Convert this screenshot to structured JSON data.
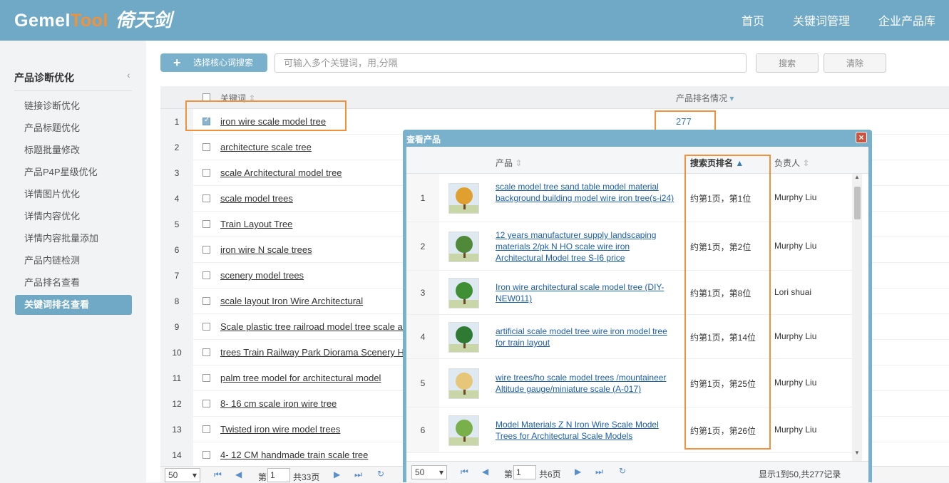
{
  "header": {
    "logo_a": "Gemel",
    "logo_b": "Tool",
    "logo_cn": "倚天剑",
    "nav": [
      "首页",
      "关键词管理",
      "企业产品库"
    ]
  },
  "sidebar": {
    "title": "产品诊断优化",
    "items": [
      "链接诊断优化",
      "产品标题优化",
      "标题批量修改",
      "产品P4P星级优化",
      "详情图片优化",
      "详情内容优化",
      "详情内容批量添加",
      "产品内链检测",
      "产品排名查看",
      "关键词排名查看"
    ],
    "active_index": 9
  },
  "toolbar": {
    "select_label": "选择核心词搜索",
    "input_placeholder": "可输入多个关键词，用,分隔",
    "search_label": "搜索",
    "clear_label": "清除"
  },
  "table": {
    "col_keyword": "关键词",
    "col_rank": "产品排名情况",
    "rows": [
      {
        "n": "1",
        "kw": "iron wire scale model tree",
        "rank": "277",
        "checked": true
      },
      {
        "n": "2",
        "kw": "architecture scale tree"
      },
      {
        "n": "3",
        "kw": "scale Architectural model tree"
      },
      {
        "n": "4",
        "kw": "scale model trees"
      },
      {
        "n": "5",
        "kw": "Train Layout Tree"
      },
      {
        "n": "6",
        "kw": "iron wire N scale trees"
      },
      {
        "n": "7",
        "kw": "scenery model trees"
      },
      {
        "n": "8",
        "kw": "scale layout Iron Wire Architectural"
      },
      {
        "n": "9",
        "kw": "Scale plastic tree railroad model tree scale ar"
      },
      {
        "n": "10",
        "kw": "trees Train Railway Park Diorama Scenery HO"
      },
      {
        "n": "11",
        "kw": "palm tree model for architectural model"
      },
      {
        "n": "12",
        "kw": "8- 16 cm scale iron wire tree"
      },
      {
        "n": "13",
        "kw": "Twisted iron wire model trees"
      },
      {
        "n": "14",
        "kw": "4- 12 CM handmade train scale tree"
      }
    ]
  },
  "pager": {
    "size": "50",
    "page_label": "第",
    "page": "1",
    "total": "共33页"
  },
  "dialog": {
    "title": "查看产品",
    "col_product": "产品",
    "col_rank": "搜索页排名",
    "col_owner": "负责人",
    "rows": [
      {
        "n": "1",
        "name": "scale model tree sand table model material background building model wire iron tree(s-i24)",
        "rank": "约第1页，第1位",
        "owner": "Murphy Liu",
        "icon": "autumn-tree-icon",
        "color": "#e0a030"
      },
      {
        "n": "2",
        "name": "12 years manufacturer supply landscaping materials 2/pk N HO scale wire iron Architectural Model tree S-I6 price",
        "rank": "约第1页，第2位",
        "owner": "Murphy Liu",
        "icon": "round-tree-icon",
        "color": "#4f8a3a"
      },
      {
        "n": "3",
        "name": "Iron wire architectural scale model tree (DIY-NEW011)",
        "rank": "约第1页，第8位",
        "owner": "Lori shuai",
        "icon": "leafy-tree-icon",
        "color": "#3f8f34"
      },
      {
        "n": "4",
        "name": "artificial scale model tree wire iron model tree for train layout",
        "rank": "约第1页，第14位",
        "owner": "Murphy Liu",
        "icon": "pine-tree-icon",
        "color": "#2f7a32"
      },
      {
        "n": "5",
        "name": "wire trees/ho scale model trees /mountaineer Altitude gauge/miniature scale (A-017)",
        "rank": "约第1页，第25位",
        "owner": "Murphy Liu",
        "icon": "blossom-tree-icon",
        "color": "#e6c77a"
      },
      {
        "n": "6",
        "name": "Model Materials Z N Iron Wire Scale Model Trees for Architectural Scale Models",
        "rank": "约第1页，第26位",
        "owner": "Murphy Liu",
        "icon": "sprig-tree-icon",
        "color": "#7ab04a"
      }
    ],
    "pager": {
      "size": "50",
      "page_label": "第",
      "page": "1",
      "total": "共6页",
      "summary": "显示1到50,共277记录"
    }
  },
  "colors": {
    "header": "#6fa9c6",
    "highlight": "#f0923c",
    "link": "#1f5fa8"
  }
}
